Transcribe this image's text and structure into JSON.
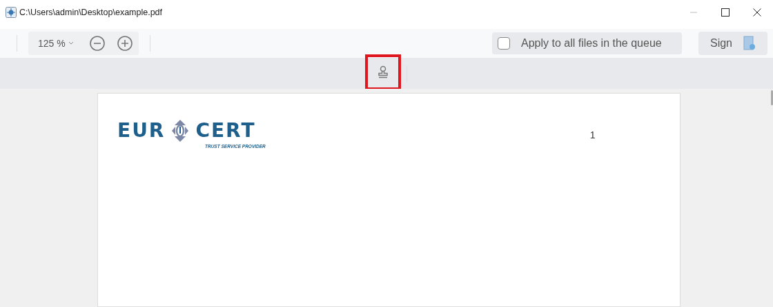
{
  "window": {
    "title": "C:\\Users\\admin\\Desktop\\example.pdf"
  },
  "toolbar": {
    "zoom": "125 %",
    "apply_all": {
      "label": "Apply to all files in the queue",
      "checked": false
    },
    "sign_button": "Sign"
  },
  "stamp_tool": {
    "selected": true
  },
  "document": {
    "logo": {
      "left": "EUR",
      "right": "CERT",
      "tagline": "TRUST SERVICE PROVIDER"
    },
    "page_number": "1"
  }
}
